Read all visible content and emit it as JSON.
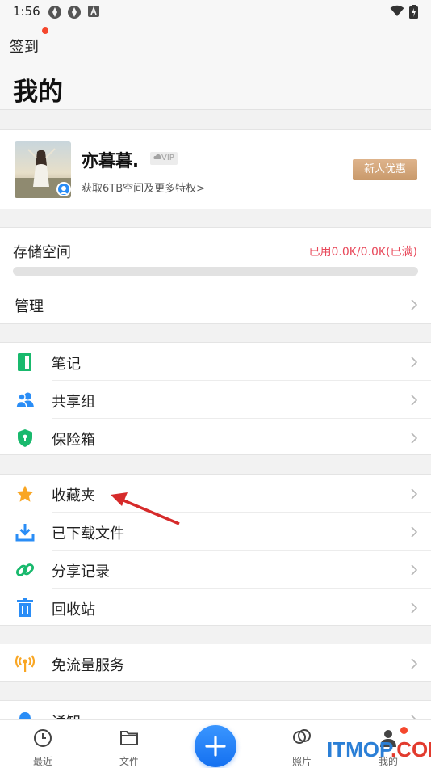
{
  "status_bar": {
    "time": "1:56"
  },
  "header": {
    "checkin_label": "签到",
    "title": "我的"
  },
  "profile": {
    "username": "亦暮暮.",
    "vip_label": "VIP",
    "subtitle": "获取6TB空间及更多特权>",
    "promo_button": "新人优惠"
  },
  "storage": {
    "title": "存储空间",
    "usage_text": "已用0.0K/0.0K(已满)",
    "used_fraction": 0,
    "manage_label": "管理"
  },
  "menu_group_1": [
    {
      "label": "笔记",
      "icon": "note-icon"
    },
    {
      "label": "共享组",
      "icon": "share-group-icon"
    },
    {
      "label": "保险箱",
      "icon": "safe-box-icon"
    }
  ],
  "menu_group_2": [
    {
      "label": "收藏夹",
      "icon": "star-icon"
    },
    {
      "label": "已下载文件",
      "icon": "download-icon"
    },
    {
      "label": "分享记录",
      "icon": "link-icon"
    },
    {
      "label": "回收站",
      "icon": "trash-icon"
    }
  ],
  "menu_group_3": [
    {
      "label": "免流量服务",
      "icon": "signal-tower-icon"
    }
  ],
  "menu_group_4": [
    {
      "label": "通知",
      "icon": "bell-icon"
    }
  ],
  "bottom_nav": [
    {
      "label": "最近",
      "icon": "clock-icon"
    },
    {
      "label": "文件",
      "icon": "folder-icon"
    },
    {
      "label": "",
      "icon": "plus-icon"
    },
    {
      "label": "照片",
      "icon": "photo-icon"
    },
    {
      "label": "我的",
      "icon": "person-icon"
    }
  ],
  "watermark": {
    "brand": "ITMOP",
    "suffix": ".COM"
  },
  "colors": {
    "accent_blue": "#2a8df6",
    "usage_red": "#e8485a",
    "note_green": "#19b96d",
    "star_orange": "#f9a623",
    "promo_gold": "#d3a779",
    "arrow_red": "#d62b2b"
  }
}
